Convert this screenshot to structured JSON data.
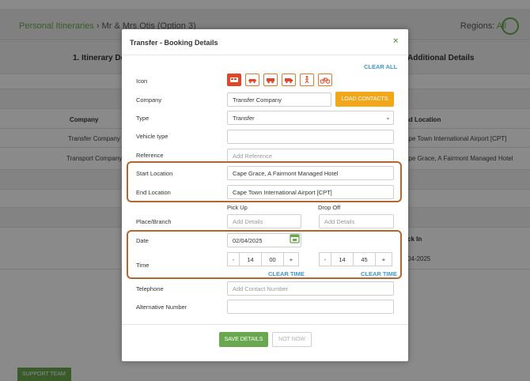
{
  "background": {
    "breadcrumb": {
      "link": "Personal Itineraries",
      "separator": "›",
      "current": "Mr & Mrs Otis (Option 3)"
    },
    "regions": {
      "label": "Regions:",
      "value": "All"
    },
    "section_left": "1. Itinerary Deta",
    "section_right": "Additional Details",
    "table": {
      "col_company": "Company",
      "col_end": "nd Location",
      "rows": [
        {
          "company": "Transfer Company",
          "end": "ape Town International Airport [CPT]"
        },
        {
          "company": "Transport Company",
          "end": "ape Grace, A Fairmont Managed Hotel"
        }
      ]
    },
    "lower": {
      "heading": "ck In",
      "value": "04-2025"
    },
    "bottom_button": "SUPPORT TEAM"
  },
  "modal": {
    "title": "Transfer - Booking Details",
    "clear_all": "CLEAR ALL",
    "labels": {
      "icon": "Icon",
      "company": "Company",
      "type": "Type",
      "vehicle_type": "Vehicle type",
      "reference": "Reference",
      "start_location": "Start Location",
      "end_location": "End Location",
      "place_branch": "Place/Branch",
      "date": "Date",
      "time": "Time",
      "telephone": "Telephone",
      "alternative_number": "Alternative Number"
    },
    "icons": [
      "bus-icon",
      "car-icon",
      "jeep-icon",
      "van-icon",
      "walking-icon",
      "bicycle-icon"
    ],
    "active_icon": "bus-icon",
    "fields": {
      "company": "Transfer Company",
      "load_contacts": "LOAD CONTACTS",
      "type": "Transfer",
      "vehicle_type": "",
      "reference_placeholder": "Add Reference",
      "start_location": "Cape Grace, A Fairmont Managed Hotel",
      "end_location": "Cape Town International Airport [CPT]",
      "pickup_heading": "Pick Up",
      "dropoff_heading": "Drop Off",
      "pickup_placeholder": "Add Details",
      "dropoff_placeholder": "Add Details",
      "date": "02/04/2025",
      "pickup_time": {
        "minus": "-",
        "hour": "14",
        "minute": "00",
        "plus": "+"
      },
      "dropoff_time": {
        "minus": "-",
        "hour": "14",
        "minute": "45",
        "plus": "+"
      },
      "clear_time": "CLEAR TIME",
      "telephone_placeholder": "Add Contact Number",
      "alternative_number": ""
    },
    "buttons": {
      "save": "SAVE DETAILS",
      "not_now": "NOT NOW"
    }
  },
  "colors": {
    "accent_green": "#6aa84f",
    "accent_orange": "#f2a71b",
    "icon_red": "#e0462a",
    "link_blue": "#3d9ad1",
    "highlight_brown": "#b5662e"
  }
}
